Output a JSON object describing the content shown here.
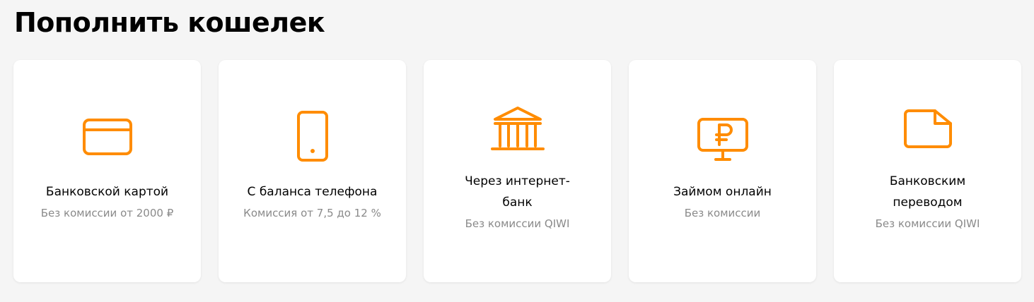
{
  "page": {
    "title": "Пополнить кошелек"
  },
  "colors": {
    "accent": "#ff8c00",
    "background": "#f5f5f5",
    "card": "#ffffff",
    "subtitle": "#8a8a8a"
  },
  "cards": [
    {
      "icon": "credit-card-icon",
      "title": "Банковской картой",
      "subtitle": "Без комиссии от 2000 ₽"
    },
    {
      "icon": "mobile-phone-icon",
      "title": "С баланса телефона",
      "subtitle": "Комиссия от 7,5 до 12 %"
    },
    {
      "icon": "bank-building-icon",
      "title": "Через интернет-банк",
      "subtitle": "Без комиссии QIWI"
    },
    {
      "icon": "monitor-ruble-icon",
      "title": "Займом онлайн",
      "subtitle": "Без комиссии"
    },
    {
      "icon": "document-transfer-icon",
      "title": "Банковским переводом",
      "subtitle": "Без комиссии QIWI"
    }
  ]
}
